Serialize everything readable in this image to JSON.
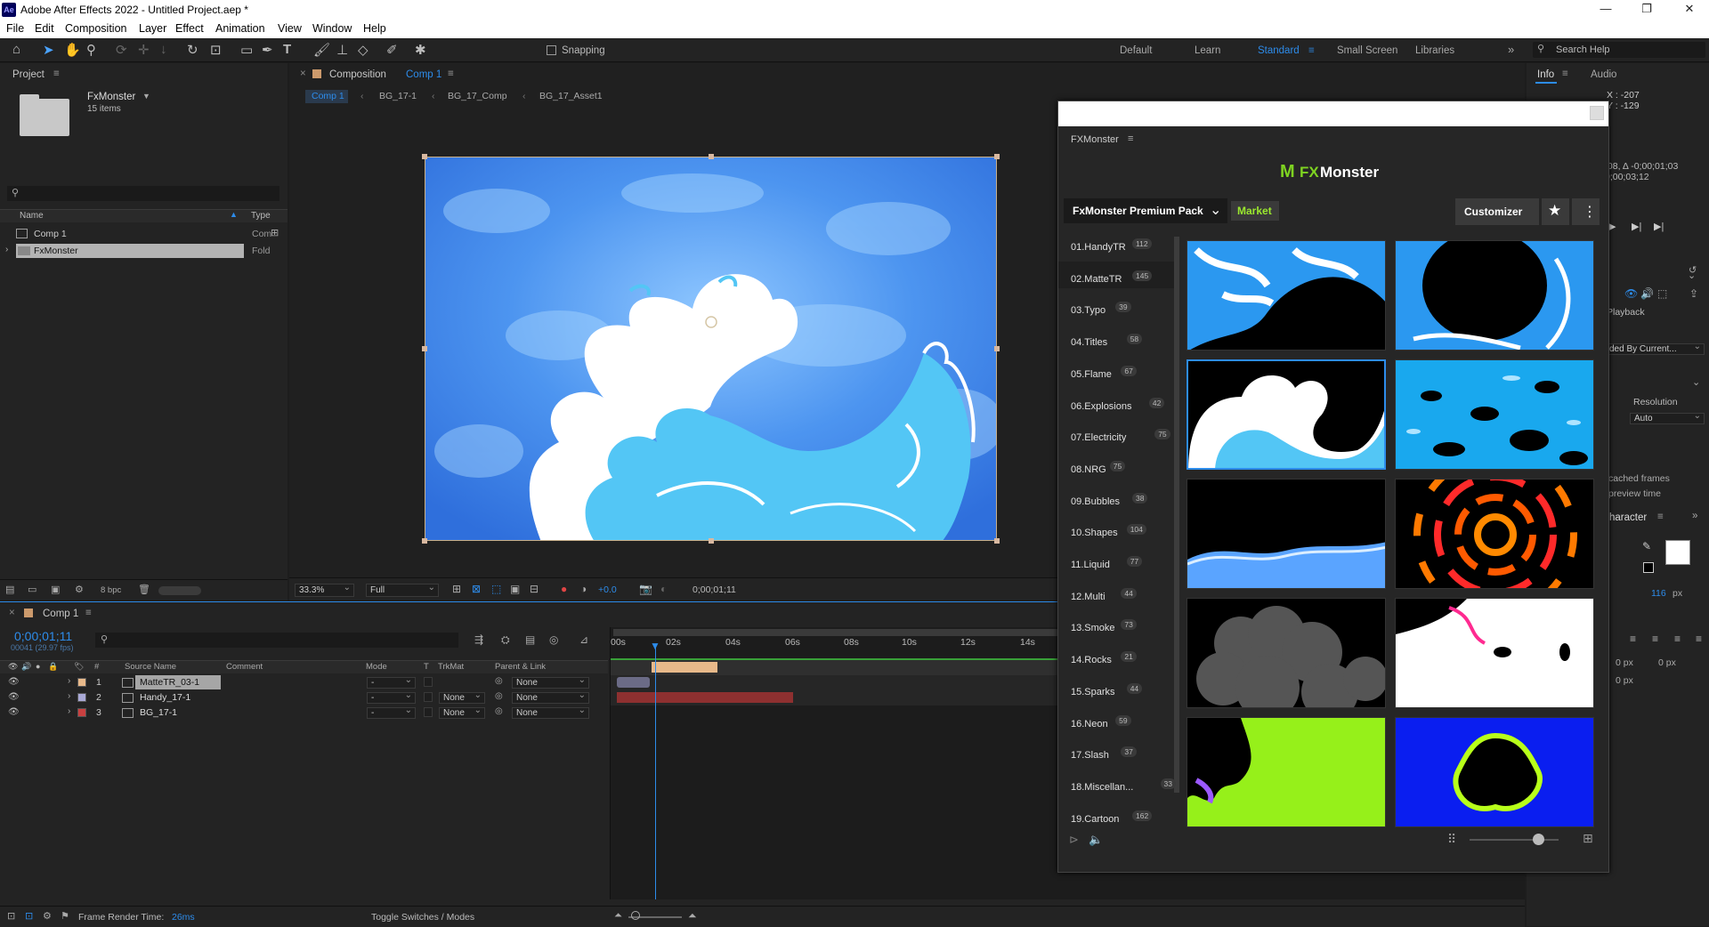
{
  "window": {
    "title": "Adobe After Effects 2022 - Untitled Project.aep *",
    "icon": "Ae"
  },
  "menu": [
    "File",
    "Edit",
    "Composition",
    "Layer",
    "Effect",
    "Animation",
    "View",
    "Window",
    "Help"
  ],
  "toolbar": {
    "snapping": "Snapping",
    "workspaces": [
      "Default",
      "Learn",
      "Standard",
      "Small Screen",
      "Libraries"
    ],
    "active_workspace": "Standard",
    "search_placeholder": "Search Help"
  },
  "project": {
    "tab": "Project",
    "folder_name": "FxMonster",
    "items_count": "15 items",
    "col_name": "Name",
    "col_type": "Type",
    "items": [
      {
        "name": "Comp 1",
        "type": "Com"
      },
      {
        "name": "FxMonster",
        "type": "Fold"
      }
    ],
    "bpc": "8 bpc"
  },
  "composition": {
    "tab_prefix": "Composition",
    "tab_name": "Comp 1",
    "breadcrumbs": [
      "Comp 1",
      "BG_17-1",
      "BG_17_Comp",
      "BG_17_Asset1"
    ],
    "zoom": "33.3%",
    "quality": "Full",
    "exposure": "+0.0",
    "timecode": "0;00;01;11"
  },
  "timeline": {
    "tab": "Comp 1",
    "timecode": "0;00;01;11",
    "fps": "00041 (29.97 fps)",
    "cols": {
      "num": "#",
      "source": "Source Name",
      "comment": "Comment",
      "mode": "Mode",
      "t": "T",
      "trkmat": "TrkMat",
      "parent": "Parent & Link"
    },
    "ruler": [
      "00s",
      "02s",
      "04s",
      "06s",
      "08s",
      "10s",
      "12s",
      "14s"
    ],
    "layers": [
      {
        "num": "1",
        "name": "MatteTR_03-1",
        "mode": "-",
        "trkmat": "",
        "parent": "None",
        "color": "#e8b98a"
      },
      {
        "num": "2",
        "name": "Handy_17-1",
        "mode": "-",
        "trkmat": "None",
        "parent": "None",
        "color": "#a9a9d6"
      },
      {
        "num": "3",
        "name": "BG_17-1",
        "mode": "-",
        "trkmat": "None",
        "parent": "None",
        "color": "#c94040"
      }
    ],
    "render_label": "Frame Render Time:",
    "render_time": "26ms",
    "toggle": "Toggle Switches / Modes"
  },
  "fxmonster": {
    "panel_tab": "FXMonster",
    "logo_fx": "FX",
    "logo_monster": "Monster",
    "pack": "FxMonster Premium Pack",
    "market": "Market",
    "customizer": "Customizer",
    "categories": [
      {
        "name": "01.HandyTR",
        "count": "112"
      },
      {
        "name": "02.MatteTR",
        "count": "145"
      },
      {
        "name": "03.Typo",
        "count": "39"
      },
      {
        "name": "04.Titles",
        "count": "58"
      },
      {
        "name": "05.Flame",
        "count": "67"
      },
      {
        "name": "06.Explosions",
        "count": "42"
      },
      {
        "name": "07.Electricity",
        "count": "75"
      },
      {
        "name": "08.NRG",
        "count": "75"
      },
      {
        "name": "09.Bubbles",
        "count": "38"
      },
      {
        "name": "10.Shapes",
        "count": "104"
      },
      {
        "name": "11.Liquid",
        "count": "77"
      },
      {
        "name": "12.Multi",
        "count": "44"
      },
      {
        "name": "13.Smoke",
        "count": "73"
      },
      {
        "name": "14.Rocks",
        "count": "21"
      },
      {
        "name": "15.Sparks",
        "count": "44"
      },
      {
        "name": "16.Neon",
        "count": "59"
      },
      {
        "name": "17.Slash",
        "count": "37"
      },
      {
        "name": "18.Miscellan...",
        "count": "33"
      },
      {
        "name": "19.Cartoon",
        "count": "162"
      }
    ]
  },
  "info": {
    "tabs": [
      "Info",
      "Audio"
    ],
    "x": "X : -207",
    "y": "Y : -129",
    "time1": ";08, Δ -0;00;01;03",
    "time2": "0;00;03;12",
    "playback": "Playback",
    "dropdown": "ded By Current...",
    "resolution_label": "Resolution",
    "resolution": "Auto",
    "cached": "cached frames",
    "preview": "preview time",
    "character": "haracter",
    "font_size": "116",
    "px": "px",
    "zero_px": "0 px"
  },
  "colors": {
    "accent": "#2d8ceb",
    "market_green": "#9be82e",
    "fx_green": "#7ed321"
  }
}
